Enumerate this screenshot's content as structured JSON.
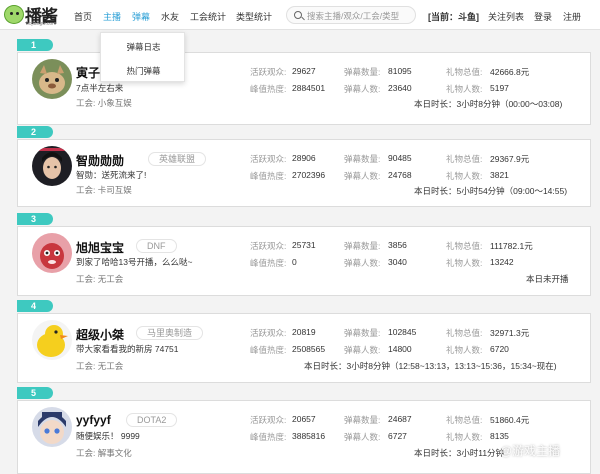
{
  "header": {
    "logo_text": "播酱",
    "logo_sub": "bojiangw.com",
    "nav": [
      "首页",
      "主播",
      "弹幕",
      "水友",
      "工会统计",
      "类型统计"
    ],
    "search_placeholder": "搜索主播/观众/工会/类型",
    "current": "[当前：斗鱼]",
    "links": [
      "关注列表",
      "登录",
      "注册"
    ]
  },
  "dropdown": [
    "弹幕日志",
    "热门弹幕"
  ],
  "labels": {
    "active_viewers": "活跃观众:",
    "danmu_count": "弹幕数量:",
    "gift_total": "礼物总值:",
    "peak_heat": "峰值热度:",
    "danmu_people": "弹幕人数:",
    "gift_people": "礼物人数:",
    "guild": "工会:"
  },
  "streamers": [
    {
      "rank": "1",
      "name": "寅子",
      "tag": "",
      "desc": "7点半左右来",
      "guild": "小象互娱",
      "active": "29627",
      "danmu": "81095",
      "gift": "42666.8元",
      "heat": "2884501",
      "danmu_people": "23640",
      "gift_people": "5197",
      "live": "本日时长：3小时8分钟（00:00～03:08)"
    },
    {
      "rank": "2",
      "name": "智勋勋勋",
      "tag": "英雄联盟",
      "desc": "智勋：送死流来了!",
      "guild": "卡司互娱",
      "active": "28906",
      "danmu": "90485",
      "gift": "29367.9元",
      "heat": "2702396",
      "danmu_people": "24768",
      "gift_people": "3821",
      "live": "本日时长：5小时54分钟（09:00～14:55)"
    },
    {
      "rank": "3",
      "name": "旭旭宝宝",
      "tag": "DNF",
      "desc": "到家了哈哈13号开播，么么哒~",
      "guild": "无工会",
      "active": "25731",
      "danmu": "3856",
      "gift": "111782.1元",
      "heat": "0",
      "danmu_people": "3040",
      "gift_people": "13242",
      "live": "本日未开播"
    },
    {
      "rank": "4",
      "name": "超级小桀",
      "tag": "马里奥制造",
      "desc": "带大家看看我的新房 74751",
      "guild": "无工会",
      "active": "20819",
      "danmu": "102845",
      "gift": "32971.3元",
      "heat": "2508565",
      "danmu_people": "14800",
      "gift_people": "6720",
      "live": "本日时长：3小时8分钟（12:58~13:13，13:13~15:36，15:34~现在)"
    },
    {
      "rank": "5",
      "name": "yyfyyf",
      "tag": "DOTA2",
      "desc": "随便娱乐！ 9999",
      "guild": "解事文化",
      "active": "20657",
      "danmu": "24687",
      "gift": "51860.4元",
      "heat": "3885816",
      "danmu_people": "6727",
      "gift_people": "8135",
      "live": "本日时长：3小时11分钟"
    }
  ],
  "watermark": "@游戏主播"
}
